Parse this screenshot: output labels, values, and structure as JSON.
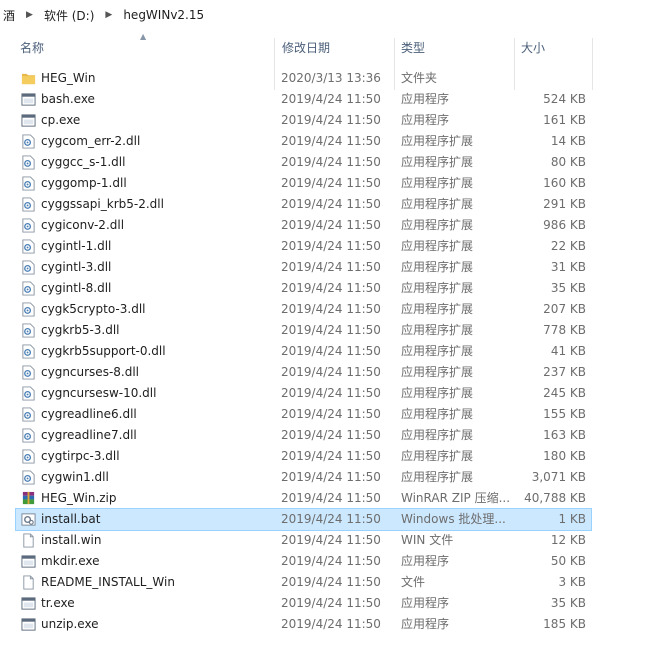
{
  "breadcrumb": {
    "items": [
      "酒",
      "软件 (D:)",
      "hegWINv2.15"
    ]
  },
  "columns": {
    "name": "名称",
    "date": "修改日期",
    "type": "类型",
    "size": "大小"
  },
  "files": [
    {
      "name": "HEG_Win",
      "date": "2020/3/13 13:36",
      "type": "文件夹",
      "size": "",
      "icon": "folder-icon"
    },
    {
      "name": "bash.exe",
      "date": "2019/4/24 11:50",
      "type": "应用程序",
      "size": "524 KB",
      "icon": "exe-icon"
    },
    {
      "name": "cp.exe",
      "date": "2019/4/24 11:50",
      "type": "应用程序",
      "size": "161 KB",
      "icon": "exe-icon"
    },
    {
      "name": "cygcom_err-2.dll",
      "date": "2019/4/24 11:50",
      "type": "应用程序扩展",
      "size": "14 KB",
      "icon": "dll-icon"
    },
    {
      "name": "cyggcc_s-1.dll",
      "date": "2019/4/24 11:50",
      "type": "应用程序扩展",
      "size": "80 KB",
      "icon": "dll-icon"
    },
    {
      "name": "cyggomp-1.dll",
      "date": "2019/4/24 11:50",
      "type": "应用程序扩展",
      "size": "160 KB",
      "icon": "dll-icon"
    },
    {
      "name": "cyggssapi_krb5-2.dll",
      "date": "2019/4/24 11:50",
      "type": "应用程序扩展",
      "size": "291 KB",
      "icon": "dll-icon"
    },
    {
      "name": "cygiconv-2.dll",
      "date": "2019/4/24 11:50",
      "type": "应用程序扩展",
      "size": "986 KB",
      "icon": "dll-icon"
    },
    {
      "name": "cygintl-1.dll",
      "date": "2019/4/24 11:50",
      "type": "应用程序扩展",
      "size": "22 KB",
      "icon": "dll-icon"
    },
    {
      "name": "cygintl-3.dll",
      "date": "2019/4/24 11:50",
      "type": "应用程序扩展",
      "size": "31 KB",
      "icon": "dll-icon"
    },
    {
      "name": "cygintl-8.dll",
      "date": "2019/4/24 11:50",
      "type": "应用程序扩展",
      "size": "35 KB",
      "icon": "dll-icon"
    },
    {
      "name": "cygk5crypto-3.dll",
      "date": "2019/4/24 11:50",
      "type": "应用程序扩展",
      "size": "207 KB",
      "icon": "dll-icon"
    },
    {
      "name": "cygkrb5-3.dll",
      "date": "2019/4/24 11:50",
      "type": "应用程序扩展",
      "size": "778 KB",
      "icon": "dll-icon"
    },
    {
      "name": "cygkrb5support-0.dll",
      "date": "2019/4/24 11:50",
      "type": "应用程序扩展",
      "size": "41 KB",
      "icon": "dll-icon"
    },
    {
      "name": "cygncurses-8.dll",
      "date": "2019/4/24 11:50",
      "type": "应用程序扩展",
      "size": "237 KB",
      "icon": "dll-icon"
    },
    {
      "name": "cygncursesw-10.dll",
      "date": "2019/4/24 11:50",
      "type": "应用程序扩展",
      "size": "245 KB",
      "icon": "dll-icon"
    },
    {
      "name": "cygreadline6.dll",
      "date": "2019/4/24 11:50",
      "type": "应用程序扩展",
      "size": "155 KB",
      "icon": "dll-icon"
    },
    {
      "name": "cygreadline7.dll",
      "date": "2019/4/24 11:50",
      "type": "应用程序扩展",
      "size": "163 KB",
      "icon": "dll-icon"
    },
    {
      "name": "cygtirpc-3.dll",
      "date": "2019/4/24 11:50",
      "type": "应用程序扩展",
      "size": "180 KB",
      "icon": "dll-icon"
    },
    {
      "name": "cygwin1.dll",
      "date": "2019/4/24 11:50",
      "type": "应用程序扩展",
      "size": "3,071 KB",
      "icon": "dll-icon"
    },
    {
      "name": "HEG_Win.zip",
      "date": "2019/4/24 11:50",
      "type": "WinRAR ZIP 压缩...",
      "size": "40,788 KB",
      "icon": "winrar-icon"
    },
    {
      "name": "install.bat",
      "date": "2019/4/24 11:50",
      "type": "Windows 批处理...",
      "size": "1 KB",
      "icon": "bat-icon",
      "selected": true
    },
    {
      "name": "install.win",
      "date": "2019/4/24 11:50",
      "type": "WIN 文件",
      "size": "12 KB",
      "icon": "file-icon"
    },
    {
      "name": "mkdir.exe",
      "date": "2019/4/24 11:50",
      "type": "应用程序",
      "size": "50 KB",
      "icon": "exe-icon"
    },
    {
      "name": "README_INSTALL_Win",
      "date": "2019/4/24 11:50",
      "type": "文件",
      "size": "3 KB",
      "icon": "file-icon"
    },
    {
      "name": "tr.exe",
      "date": "2019/4/24 11:50",
      "type": "应用程序",
      "size": "35 KB",
      "icon": "exe-icon"
    },
    {
      "name": "unzip.exe",
      "date": "2019/4/24 11:50",
      "type": "应用程序",
      "size": "185 KB",
      "icon": "exe-icon"
    }
  ]
}
